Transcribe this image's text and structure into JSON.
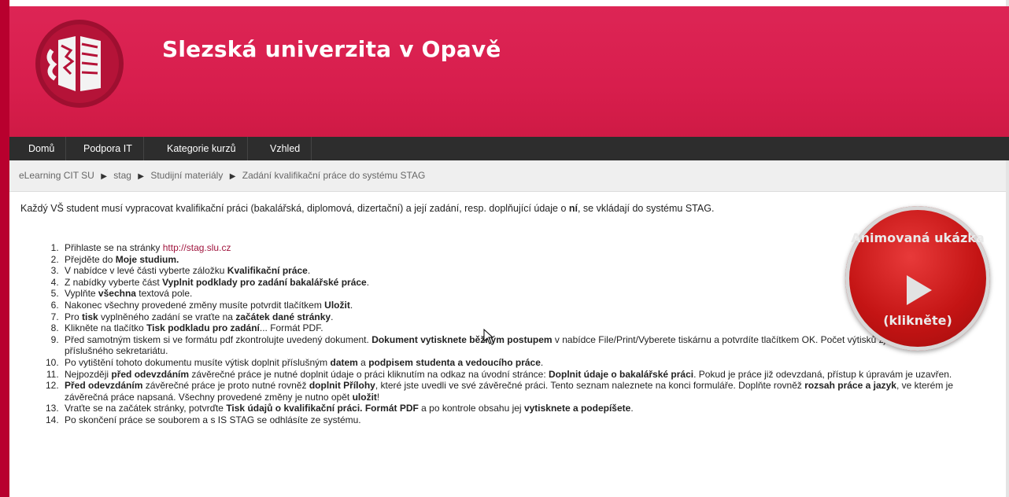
{
  "header": {
    "site_title": "Slezská univerzita v Opavě",
    "logo_icon": "university-emblem-icon",
    "brand_color": "#d81e4d"
  },
  "nav": {
    "items": [
      {
        "label": "Domů"
      },
      {
        "label": "Podpora IT"
      },
      {
        "label": "Kategorie kurzů"
      },
      {
        "label": "Vzhled"
      }
    ]
  },
  "breadcrumb": {
    "items": [
      {
        "label": "eLearning CIT SU"
      },
      {
        "label": "stag"
      },
      {
        "label": "Studijní materiály"
      },
      {
        "label": "Zadání kvalifikační práce do systému STAG"
      }
    ],
    "separator": "▶"
  },
  "content": {
    "intro_start": "Každý VŠ student musí vypracovat kvalifikační práci (bakalářská, diplomová, dizertační) a její zadání, resp. doplňující údaje o ",
    "intro_bold": "ní",
    "intro_end": ", se vkládají do systému STAG.",
    "steps": [
      {
        "t1": "Přihlaste se na stránky ",
        "link": "http://stag.slu.cz"
      },
      {
        "t1": "Přejděte do ",
        "b1": "Moje studium."
      },
      {
        "t1": "V nabídce v levé části vyberte záložku ",
        "b1": "Kvalifikační práce",
        "t2": "."
      },
      {
        "t1": "Z nabídky vyberte část ",
        "b1": "Vyplnit podklady pro zadání bakalářské práce",
        "t2": "."
      },
      {
        "t1": "Vyplňte ",
        "b1": "všechna",
        "t2": " textová pole."
      },
      {
        "t1": "Nakonec všechny provedené změny musíte potvrdit tlačítkem ",
        "b1": "Uložit",
        "t2": "."
      },
      {
        "t1": "Pro ",
        "b1": "tisk",
        "t2": " vyplněného zadání se vraťte na ",
        "b2": "začátek dané stránky",
        "t3": "."
      },
      {
        "t1": "Klikněte na tlačítko ",
        "b1": "Tisk podkladu pro zadání",
        "t2": "... Formát PDF."
      },
      {
        "t1": "Před samotným tiskem si ve formátu pdf zkontrolujte uvedený dokument. ",
        "b1": "Dokument vytisknete běžným postupem",
        "t2": " v nabídce File/Print/Vyberete tiskárnu a potvrdíte tlačítkem OK. Počet výtisků zjistíte na publiku příslušného sekretariátu."
      },
      {
        "t1": "Po vytištění tohoto dokumentu musíte výtisk doplnit příslušným ",
        "b1": "datem",
        "t2": " a ",
        "b2": "podpisem studenta a vedoucího práce",
        "t3": "."
      },
      {
        "t1": "Nejpozději ",
        "b1": "před odevzdáním",
        "t2": " závěrečné práce je nutné doplnit údaje o práci kliknutím na odkaz na úvodní stránce: ",
        "b2": "Doplnit údaje o bakalářské práci",
        "t3": ". Pokud je práce již odevzdaná, přístup k úpravám je uzavřen."
      },
      {
        "b0": "Před odevzdáním",
        "t1": " závěrečné práce je proto nutné rovněž ",
        "b1": "doplnit Přílohy",
        "t2": ", které jste uvedli ve své závěrečné práci. Tento seznam naleznete na konci formuláře. Doplňte rovněž ",
        "b2": "rozsah práce a jazyk",
        "t3": ", ve kterém je závěrečná práce napsaná. Všechny provedené změny je nutno opět ",
        "b3": "uložit",
        "t4": "!"
      },
      {
        "t1": "Vraťte se na začátek stránky, potvrďte ",
        "b1": "Tisk údajů o kvalifikační práci. Formát PDF",
        "t2": " a po kontrole obsahu jej ",
        "b2": "vytisknete a podepíšete",
        "t3": "."
      },
      {
        "t1": "Po skončení práce se souborem a s IS STAG se odhlásíte ze systému."
      }
    ]
  },
  "promo": {
    "title": "Animovaná ukázka",
    "caption": "(klikněte)",
    "play_icon": "play-icon",
    "color": "#c41414"
  }
}
